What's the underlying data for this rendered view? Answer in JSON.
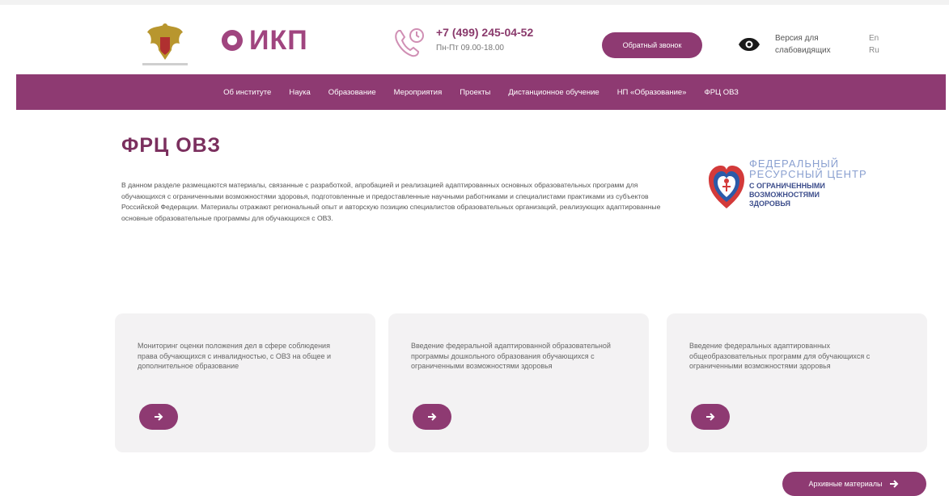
{
  "header": {
    "logo_text": "ИКП",
    "phone": "+7 (499) 245-04-52",
    "hours": "Пн-Пт 09.00-18.00",
    "callback_label": "Обратный звонок",
    "vision_line1": "Версия для",
    "vision_line2": "слабовидящих",
    "lang_en": "En",
    "lang_ru": "Ru"
  },
  "nav": {
    "items": [
      "Об институте",
      "Наука",
      "Образование",
      "Мероприятия",
      "Проекты",
      "Дистанционное обучение",
      "НП «Образование»",
      "ФРЦ ОВЗ"
    ]
  },
  "main": {
    "title": "ФРЦ ОВЗ",
    "intro": "В данном разделе размещаются материалы, связанные с разработкой, апробацией и реализацией адаптированных основных образовательных программ для обучающихся с ограниченными возможностями здоровья, подготовленные и предоставленные научными работниками и специалистами практиками из субъектов Российской Федерации. Материалы отражают региональный опыт и авторскую позицию специалистов образовательных организаций, реализующих адаптированные основные образовательные программы для обучающихся с ОВЗ.",
    "frc_logo_line1": "ФЕДЕРАЛЬНЫЙ",
    "frc_logo_line2": "РЕСУРСНЫЙ ЦЕНТР",
    "frc_logo_line3": "С ОГРАНИЧЕННЫМИ",
    "frc_logo_line4": "ВОЗМОЖНОСТЯМИ",
    "frc_logo_line5": "ЗДОРОВЬЯ"
  },
  "cards": [
    {
      "text": "Мониторинг оценки положения дел в сфере соблюдения права обучающихся с инвалидностью, с ОВЗ на общее и дополнительное образование"
    },
    {
      "text": "Введение федеральной адаптированной образовательной программы дошкольного образования обучающихся с ограниченными возможностями здоровья"
    },
    {
      "text": "Введение федеральных адаптированных общеобразовательных программ для обучающихся с ограниченными возможностями здоровья"
    }
  ],
  "archive_label": "Архивные материалы",
  "colors": {
    "brand": "#8e3a72",
    "title": "#7b2f5e",
    "card_bg": "#f3f2f3"
  },
  "icons": [
    "emblem-icon",
    "ikp-logo-icon",
    "phone-icon",
    "eye-icon",
    "arrow-right-icon",
    "frc-heart-logo-icon"
  ]
}
